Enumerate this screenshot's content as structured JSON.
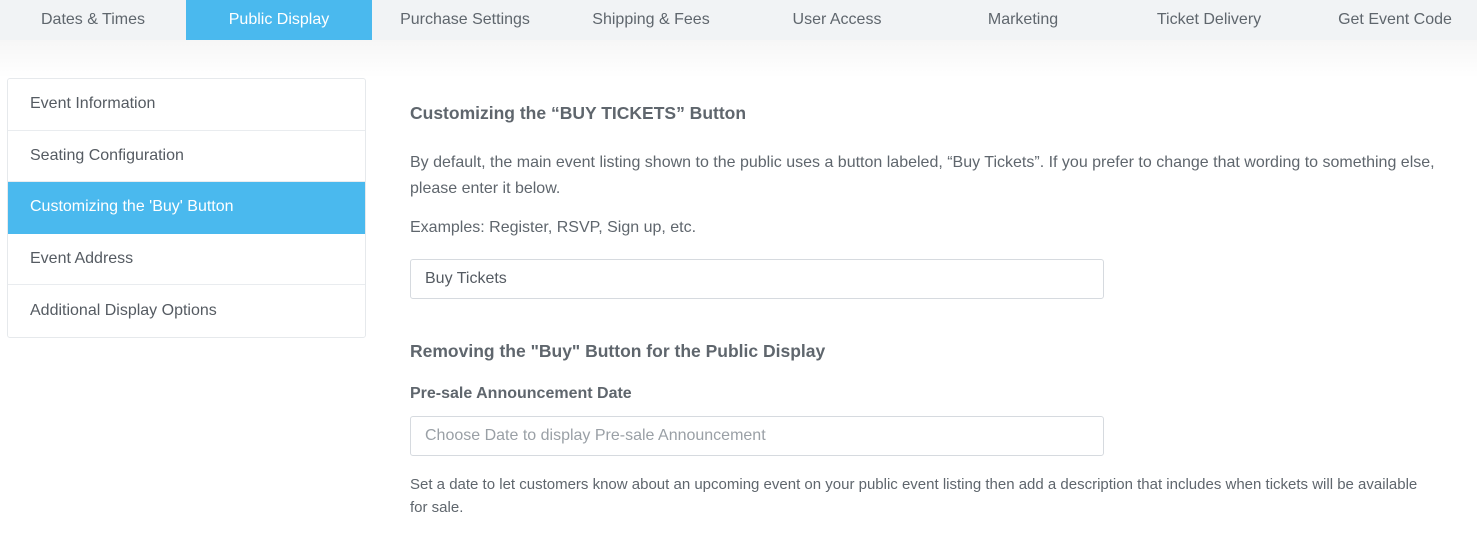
{
  "tabs": [
    {
      "label": "Dates & Times",
      "active": false
    },
    {
      "label": "Public Display",
      "active": true
    },
    {
      "label": "Purchase Settings",
      "active": false
    },
    {
      "label": "Shipping & Fees",
      "active": false
    },
    {
      "label": "User Access",
      "active": false
    },
    {
      "label": "Marketing",
      "active": false
    },
    {
      "label": "Ticket Delivery",
      "active": false
    },
    {
      "label": "Get Event Code",
      "active": false
    }
  ],
  "sidebar": {
    "items": [
      {
        "label": "Event Information",
        "active": false
      },
      {
        "label": "Seating Configuration",
        "active": false
      },
      {
        "label": "Customizing the 'Buy' Button",
        "active": true
      },
      {
        "label": "Event Address",
        "active": false
      },
      {
        "label": "Additional Display Options",
        "active": false
      }
    ]
  },
  "main": {
    "customize_heading": "Customizing the “BUY TICKETS” Button",
    "customize_description": "By default, the main event listing shown to the public uses a button labeled, “Buy Tickets”. If you prefer to change that wording to something else, please enter it below.",
    "examples": "Examples: Register, RSVP, Sign up, etc.",
    "buy_button_value": "Buy Tickets",
    "remove_heading": "Removing the \"Buy\" Button for the Public Display",
    "presale_label": "Pre-sale Announcement Date",
    "presale_placeholder": "Choose Date to display Pre-sale Announcement",
    "presale_help": "Set a date to let customers know about an upcoming event on your public event listing then add a description that includes when tickets will be available for sale."
  },
  "colors": {
    "accent": "#4ab9ee",
    "tab_bar_bg": "#f1f3f5",
    "text": "#5f666d"
  }
}
